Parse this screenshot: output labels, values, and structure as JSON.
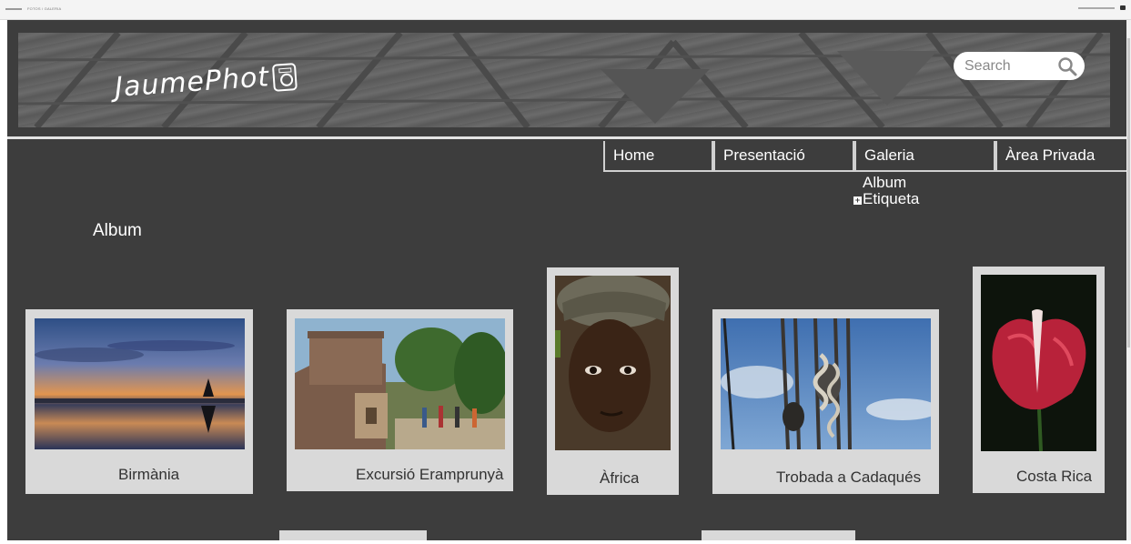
{
  "browser": {
    "left_text": "FOTOS / GALERIA"
  },
  "header": {
    "logo_text": "JaumePhot",
    "search": {
      "placeholder": "Search"
    }
  },
  "nav": {
    "items": [
      {
        "label": "Home"
      },
      {
        "label": "Presentació"
      },
      {
        "label": "Galeria"
      },
      {
        "label": "Àrea Privada"
      }
    ],
    "submenu": [
      {
        "label": "Album"
      },
      {
        "label": "Etiqueta"
      }
    ]
  },
  "main": {
    "heading": "Album",
    "albums": [
      {
        "caption": "Birmània",
        "photo": "sunset-lake-photo"
      },
      {
        "caption": "Excursió Eramprunyà",
        "photo": "castle-hike-photo"
      },
      {
        "caption": "Àfrica",
        "photo": "child-portrait-photo"
      },
      {
        "caption": "Trobada a Cadaqués",
        "photo": "sailing-ropes-photo"
      },
      {
        "caption": "Costa Rica",
        "photo": "red-flower-photo"
      }
    ]
  },
  "colors": {
    "page_background": "#3d3d3d",
    "card_background": "#d9d9d9",
    "nav_border": "#d0d0d0",
    "text_light": "#ffffff"
  }
}
